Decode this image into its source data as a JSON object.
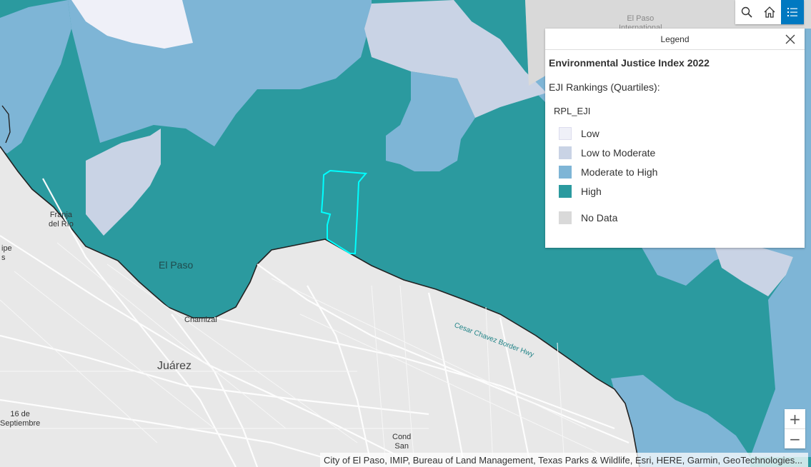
{
  "map": {
    "labels": {
      "el_paso_north": "El Paso\nInternational",
      "franja": "Franja\ndel Río",
      "felipe": "ipe\ns",
      "el_paso": "El Paso",
      "chamizal": "Chamizal",
      "juarez": "Juárez",
      "dieciseis": "16 de\nSeptiembre",
      "cond": "Cond\nSan",
      "freeway": "Cesar Chavez Border Hwy"
    },
    "colors": {
      "high": "#2b9a9f",
      "moderate_high": "#7eb5d6",
      "low_moderate": "#c9d3e5",
      "low": "#eff0f8",
      "no_data": "#d9d9d9",
      "juarez_base": "#e8e8e8",
      "selection": "#00ffff"
    }
  },
  "toolbar": {
    "search_icon": "search-icon",
    "home_icon": "home-icon",
    "legend_icon": "legend-list-icon",
    "active_color": "#0079c1"
  },
  "legend": {
    "header": "Legend",
    "title": "Environmental Justice Index 2022",
    "subtitle": "EJI Rankings (Quartiles):",
    "field": "RPL_EJI",
    "items": [
      {
        "label": "Low",
        "color": "#eff0f8"
      },
      {
        "label": "Low to Moderate",
        "color": "#c9d3e5"
      },
      {
        "label": "Moderate to High",
        "color": "#7eb5d6"
      },
      {
        "label": "High",
        "color": "#2b9a9f"
      }
    ],
    "no_data": {
      "label": "No Data",
      "color": "#d9d9d9"
    }
  },
  "zoom": {
    "in": "+",
    "out": "−"
  },
  "attribution": "City of El Paso, IMIP, Bureau of Land Management, Texas Parks & Wildlife, Esri, HERE, Garmin, GeoTechnologies..."
}
